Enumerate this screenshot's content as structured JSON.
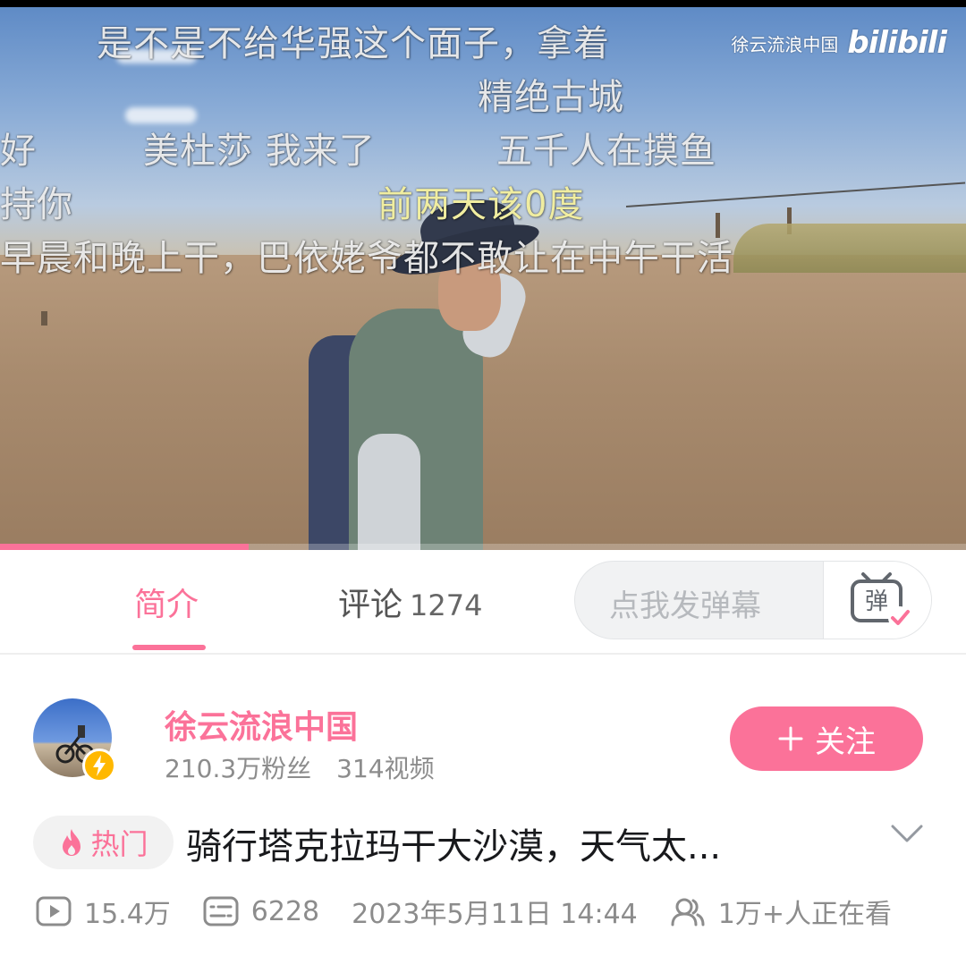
{
  "video": {
    "watermark": {
      "channel": "徐云流浪中国",
      "logo": "bilibili"
    },
    "danmaku": [
      {
        "text": "是不是不给华强这个面子，拿着",
        "color": "white"
      },
      {
        "text": "精绝古城",
        "color": "white"
      },
      {
        "text": "好",
        "color": "white"
      },
      {
        "text": "美杜莎 我来了",
        "color": "white"
      },
      {
        "text": "五千人在摸鱼",
        "color": "white"
      },
      {
        "text": "持你",
        "color": "white"
      },
      {
        "text": "前两天该0度",
        "color": "yellow"
      },
      {
        "text": "早晨和晚上干，巴依姥爷都不敢让在中午干活",
        "color": "white"
      }
    ],
    "progress": 0.257
  },
  "tabs": [
    {
      "label": "简介",
      "active": true
    },
    {
      "label": "评论",
      "count": "1274",
      "active": false
    }
  ],
  "danmaku_input": {
    "placeholder": "点我发弹幕",
    "icon": "danmaku-toggle-icon"
  },
  "uploader": {
    "name": "徐云流浪中国",
    "fans": "210.3万粉丝",
    "videos": "314视频",
    "follow_label": "关注",
    "badge_icon": "lightning-icon"
  },
  "video_info": {
    "hot_tag": "热门",
    "title": "骑行塔克拉玛干大沙漠，天气太...",
    "views": "15.4万",
    "danmaku_count": "6228",
    "date": "2023年5月11日 14:44",
    "watching": "1万+人正在看"
  },
  "colors": {
    "accent": "#fb7299",
    "badge": "#ffb800",
    "text": "#18191c",
    "muted": "#8c8c8c"
  }
}
